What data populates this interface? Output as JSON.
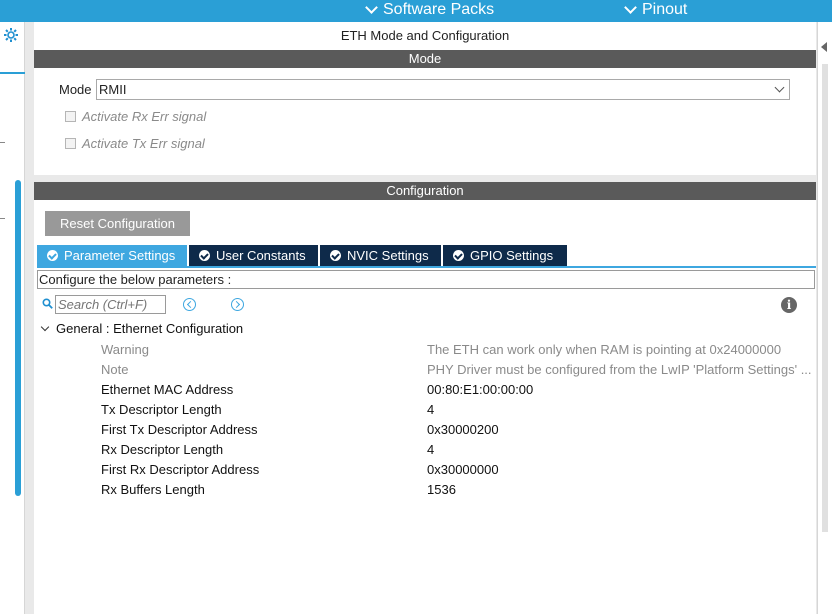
{
  "topbar": {
    "software_packs": "Software Packs",
    "pinout": "Pinout"
  },
  "panel": {
    "title": "ETH Mode and Configuration",
    "mode_section": "Mode",
    "mode_label": "Mode",
    "mode_value": "RMII",
    "rx_err": "Activate Rx Err signal",
    "tx_err": "Activate Tx Err signal"
  },
  "config": {
    "section": "Configuration",
    "reset_button": "Reset Configuration",
    "tabs": [
      {
        "label": "Parameter Settings"
      },
      {
        "label": "User Constants"
      },
      {
        "label": "NVIC Settings"
      },
      {
        "label": "GPIO Settings"
      }
    ],
    "hint": "Configure the below parameters :",
    "search_placeholder": "Search (Ctrl+F)",
    "group_title": "General : Ethernet Configuration",
    "params": [
      {
        "name": "Warning",
        "value": "The ETH can work only when RAM is pointing at 0x24000000"
      },
      {
        "name": "Note",
        "value": "PHY Driver must be configured from the LwIP 'Platform Settings' ..."
      },
      {
        "name": "Ethernet MAC Address",
        "value": "00:80:E1:00:00:00"
      },
      {
        "name": "Tx Descriptor Length",
        "value": "4"
      },
      {
        "name": "First Tx Descriptor Address",
        "value": "0x30000200"
      },
      {
        "name": "Rx Descriptor Length",
        "value": "4"
      },
      {
        "name": "First Rx Descriptor Address",
        "value": "0x30000000"
      },
      {
        "name": "Rx Buffers Length",
        "value": "1536"
      }
    ]
  },
  "icons": {
    "gear": "gear-icon",
    "search": "search-icon",
    "info": "info-icon",
    "check": "check-circle-icon"
  },
  "colors": {
    "accent": "#2a9fd6",
    "tab_active": "#3ea7e0",
    "tab_inactive": "#0e2a4a",
    "section_bar": "#5a5a5a"
  }
}
